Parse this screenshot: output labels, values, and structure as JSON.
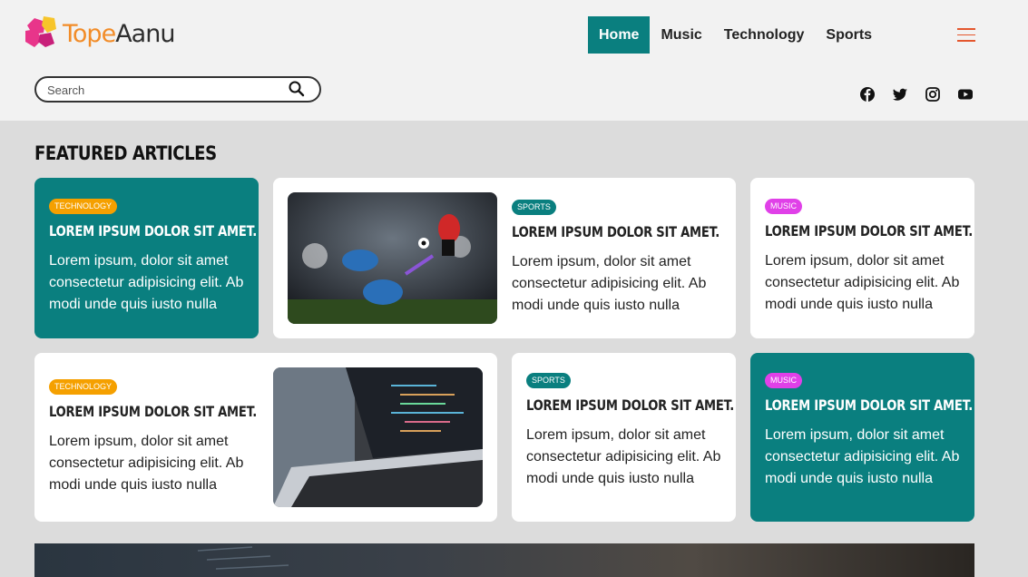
{
  "brand": {
    "part1": "Tope",
    "part2": "Aanu"
  },
  "nav": {
    "items": [
      "Home",
      "Music",
      "Technology",
      "Sports"
    ],
    "active": "Home"
  },
  "search": {
    "placeholder": "Search"
  },
  "social": [
    "facebook-icon",
    "twitter-icon",
    "instagram-icon",
    "youtube-icon"
  ],
  "section_title": "FEATURED ARTICLES",
  "colors": {
    "teal": "#0a7f7f",
    "technology_badge": "#f5a000",
    "music_badge": "#e040e8",
    "logo_orange": "#f28c28"
  },
  "cards": [
    {
      "category": "TECHNOLOGY",
      "title": "LOREM IPSUM DOLOR SIT AMET.",
      "body": "Lorem ipsum, dolor sit amet consectetur adipisicing elit. Ab modi unde quis iusto nulla"
    },
    {
      "category": "SPORTS",
      "title": "LOREM IPSUM DOLOR SIT AMET.",
      "body": "Lorem ipsum, dolor sit amet consectetur adipisicing elit. Ab modi unde quis iusto nulla"
    },
    {
      "category": "MUSIC",
      "title": "LOREM IPSUM DOLOR SIT AMET.",
      "body": "Lorem ipsum, dolor sit amet consectetur adipisicing elit. Ab modi unde quis iusto nulla"
    },
    {
      "category": "TECHNOLOGY",
      "title": "LOREM IPSUM DOLOR SIT AMET.",
      "body": "Lorem ipsum, dolor sit amet consectetur adipisicing elit. Ab modi unde quis iusto nulla"
    },
    {
      "category": "SPORTS",
      "title": "LOREM IPSUM DOLOR SIT AMET.",
      "body": "Lorem ipsum, dolor sit amet consectetur adipisicing elit. Ab modi unde quis iusto nulla"
    },
    {
      "category": "MUSIC",
      "title": "LOREM IPSUM DOLOR SIT AMET.",
      "body": "Lorem ipsum, dolor sit amet consectetur adipisicing elit. Ab modi unde quis iusto nulla"
    }
  ]
}
